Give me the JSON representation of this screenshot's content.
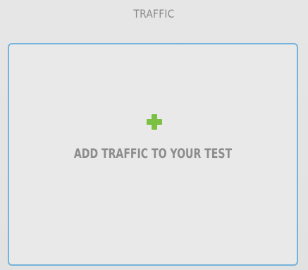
{
  "section": {
    "title": "TRAFFIC"
  },
  "add_traffic": {
    "label": "ADD TRAFFIC TO YOUR TEST",
    "icon": "plus-icon",
    "icon_color": "#7cc043",
    "border_color": "#74b3db"
  }
}
